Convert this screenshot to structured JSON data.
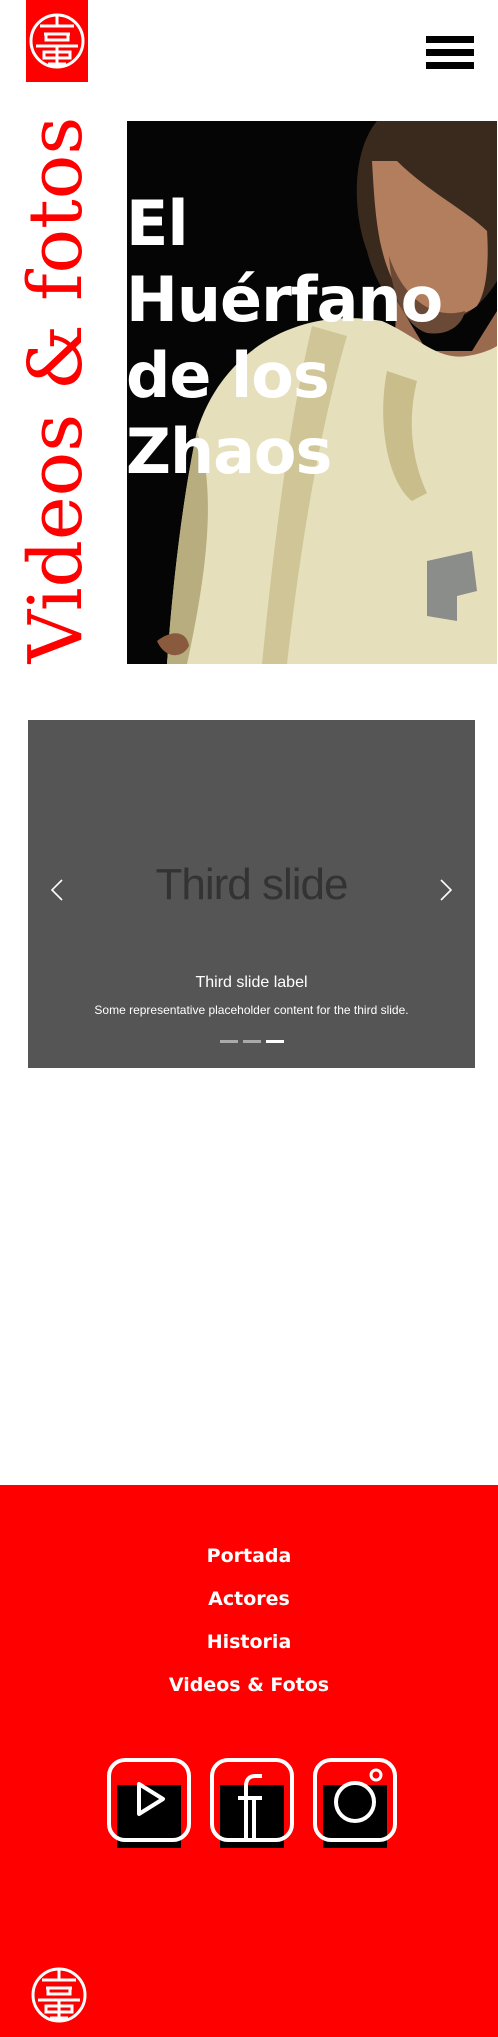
{
  "header": {
    "logo_icon": "chinese-shou-symbol-logo",
    "menu_icon": "hamburger-menu-icon"
  },
  "page": {
    "side_title": "Videos & fotos",
    "hero_title": "El Huérfano de los Zhaos"
  },
  "carousel": {
    "slide_text": "Third slide",
    "caption_title": "Third slide label",
    "caption_text": "Some representative placeholder content for the third slide.",
    "prev_icon": "chevron-left-icon",
    "next_icon": "chevron-right-icon",
    "slide_count": 3,
    "active_slide": 3
  },
  "footer": {
    "nav": [
      "Portada",
      "Actores",
      "Historia",
      "Videos & Fotos"
    ],
    "social": [
      "youtube-icon",
      "facebook-icon",
      "instagram-icon"
    ]
  },
  "colors": {
    "brand_red": "#ff0000",
    "carousel_bg": "#555555",
    "text_white": "#ffffff"
  }
}
